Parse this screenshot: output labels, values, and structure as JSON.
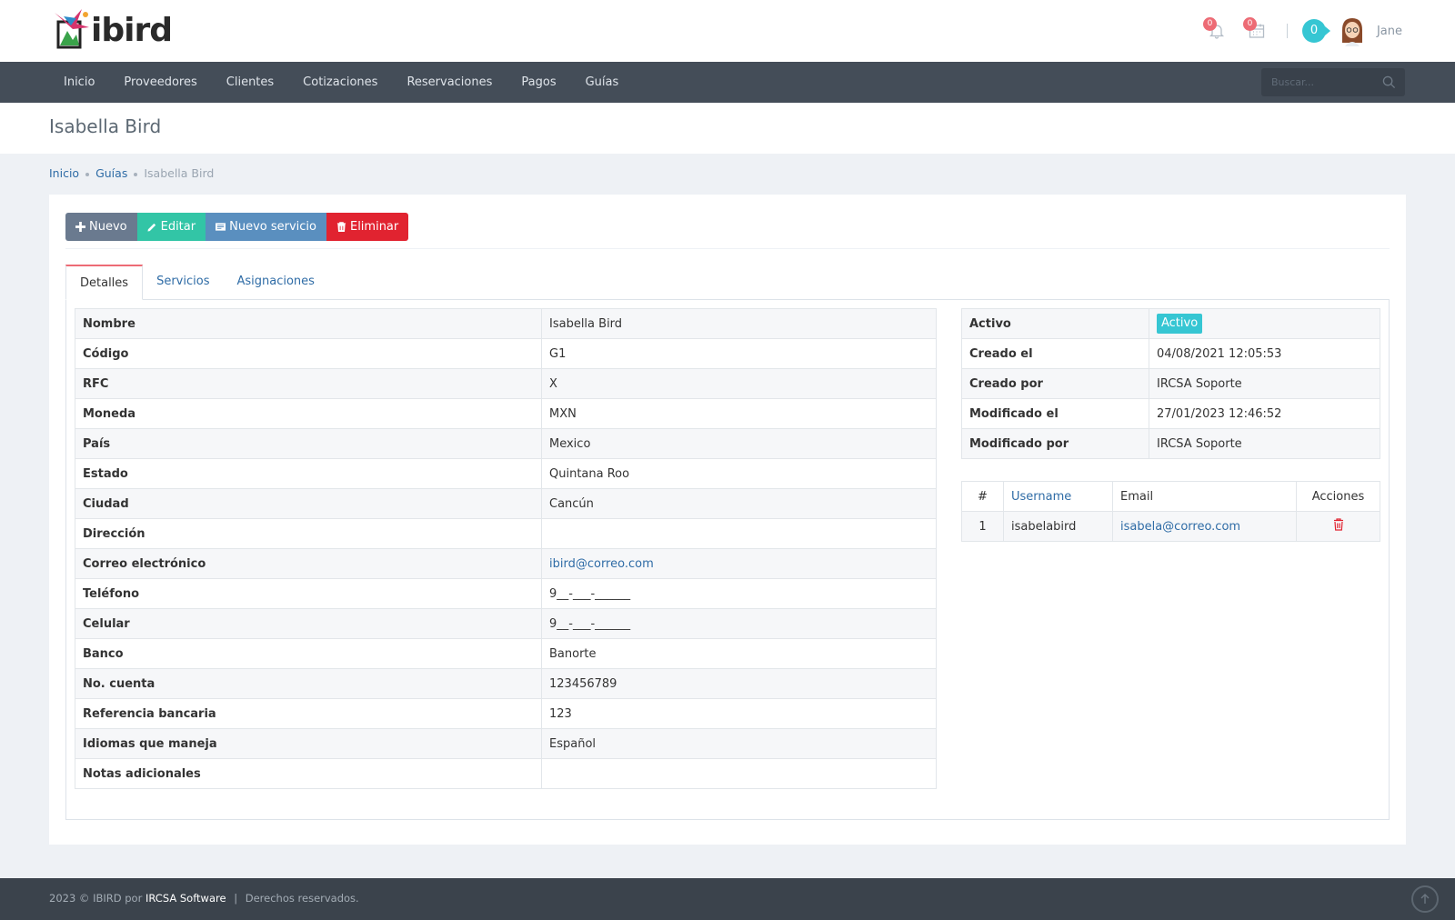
{
  "app": {
    "logo_text": "ibird",
    "notifications_count": "0",
    "calendar_count": "0",
    "messages_count": "0",
    "user_name": "Jane"
  },
  "nav": {
    "items": [
      "Inicio",
      "Proveedores",
      "Clientes",
      "Cotizaciones",
      "Reservaciones",
      "Pagos",
      "Guías"
    ],
    "search_placeholder": "Buscar..."
  },
  "page": {
    "title": "Isabella Bird"
  },
  "breadcrumb": [
    "Inicio",
    "Guías",
    "Isabella Bird"
  ],
  "actions": {
    "new_label": "Nuevo",
    "edit_label": "Editar",
    "new_service_label": "Nuevo servicio",
    "delete_label": "Eliminar"
  },
  "tabs": [
    "Detalles",
    "Servicios",
    "Asignaciones"
  ],
  "details": [
    {
      "label": "Nombre",
      "value": "Isabella Bird"
    },
    {
      "label": "Código",
      "value": "G1"
    },
    {
      "label": "RFC",
      "value": "X"
    },
    {
      "label": "Moneda",
      "value": "MXN"
    },
    {
      "label": "País",
      "value": "Mexico"
    },
    {
      "label": "Estado",
      "value": "Quintana Roo"
    },
    {
      "label": "Ciudad",
      "value": "Cancún"
    },
    {
      "label": "Dirección",
      "value": ""
    },
    {
      "label": "Correo electrónico",
      "value": "ibird@correo.com"
    },
    {
      "label": "Teléfono",
      "value": "9__-___-______"
    },
    {
      "label": "Celular",
      "value": "9__-___-______"
    },
    {
      "label": "Banco",
      "value": "Banorte"
    },
    {
      "label": "No. cuenta",
      "value": "123456789"
    },
    {
      "label": "Referencia bancaria",
      "value": "123"
    },
    {
      "label": "Idiomas que maneja",
      "value": "Español"
    },
    {
      "label": "Notas adicionales",
      "value": ""
    }
  ],
  "meta": [
    {
      "label": "Activo",
      "value": "Activo"
    },
    {
      "label": "Creado el",
      "value": "04/08/2021 12:05:53"
    },
    {
      "label": "Creado por",
      "value": "IRCSA Soporte"
    },
    {
      "label": "Modificado el",
      "value": "27/01/2023 12:46:52"
    },
    {
      "label": "Modificado por",
      "value": "IRCSA Soporte"
    }
  ],
  "users_table": {
    "headers": [
      "#",
      "Username",
      "Email",
      "Acciones"
    ],
    "rows": [
      {
        "num": "1",
        "username": "isabelabird",
        "email": "isabela@correo.com"
      }
    ]
  },
  "footer": {
    "prefix": "2023 © IBIRD por",
    "brand": "IRCSA Software",
    "separator": "|",
    "rights": "Derechos reservados."
  },
  "colors": {
    "nav_bg": "#444d58",
    "accent_teal": "#36c6d3",
    "danger": "#e12330",
    "edit_green": "#32c5a6"
  }
}
